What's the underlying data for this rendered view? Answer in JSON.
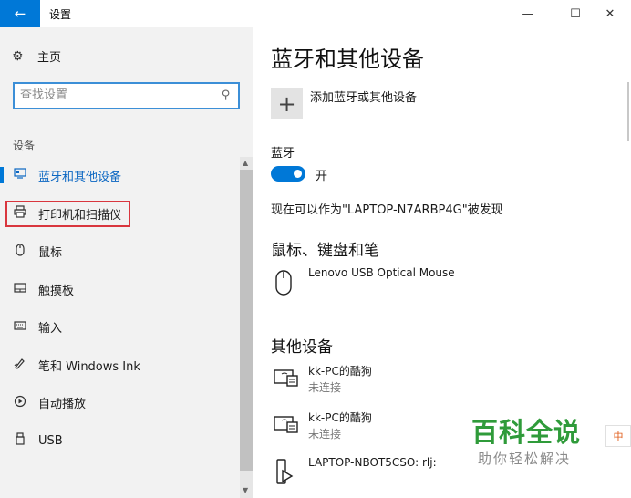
{
  "window": {
    "title": "设置",
    "back_icon": "back-arrow-icon"
  },
  "sidebar": {
    "home_label": "主页",
    "search": {
      "placeholder": "查找设置"
    },
    "section_label": "设备",
    "items": [
      {
        "label": "蓝牙和其他设备",
        "icon": "bluetooth-devices-icon",
        "active": true
      },
      {
        "label": "打印机和扫描仪",
        "icon": "printer-icon",
        "highlighted": true
      },
      {
        "label": "鼠标",
        "icon": "mouse-icon"
      },
      {
        "label": "触摸板",
        "icon": "touchpad-icon"
      },
      {
        "label": "输入",
        "icon": "keyboard-icon"
      },
      {
        "label": "笔和 Windows Ink",
        "icon": "pen-icon"
      },
      {
        "label": "自动播放",
        "icon": "autoplay-icon"
      },
      {
        "label": "USB",
        "icon": "usb-icon"
      }
    ]
  },
  "main": {
    "title": "蓝牙和其他设备",
    "add_device_label": "添加蓝牙或其他设备",
    "bluetooth": {
      "label": "蓝牙",
      "toggle_state": "开",
      "enabled": true
    },
    "discoverable_text": "现在可以作为\"LAPTOP-N7ARBP4G\"被发现",
    "mouse_section": {
      "title": "鼠标、键盘和笔",
      "devices": [
        {
          "name": "Lenovo USB Optical Mouse",
          "icon": "mouse-device-icon"
        }
      ]
    },
    "other_section": {
      "title": "其他设备",
      "devices": [
        {
          "name": "kk-PC的酷狗",
          "status": "未连接",
          "icon": "media-device-icon"
        },
        {
          "name": "kk-PC的酷狗",
          "status": "未连接",
          "icon": "media-device-icon"
        },
        {
          "name": "LAPTOP-NBOT5CSO: rlj:",
          "icon": "media-player-icon"
        }
      ]
    }
  },
  "watermark": {
    "main": "百科全说",
    "sub": "助你轻松解决",
    "tag": "中"
  },
  "colors": {
    "accent": "#0078d7",
    "highlight_box": "#d9363e",
    "watermark": "#2f9b3a"
  }
}
